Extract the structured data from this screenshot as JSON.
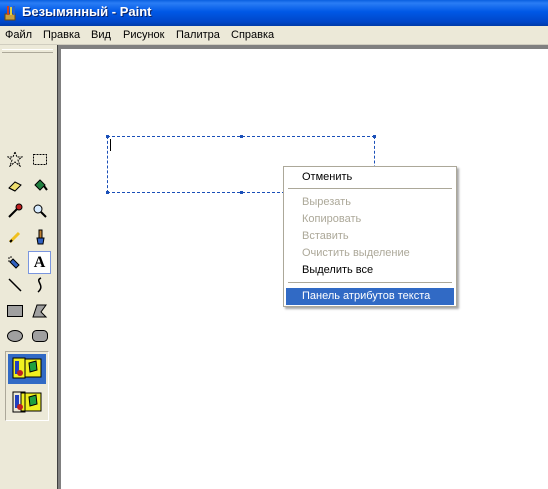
{
  "window": {
    "title": "Безымянный - Paint",
    "title_bar_color": "#0054e3",
    "app_icon": "paint-app-icon"
  },
  "menubar": {
    "items": [
      "Файл",
      "Правка",
      "Вид",
      "Рисунок",
      "Палитра",
      "Справка"
    ]
  },
  "toolbox": {
    "tools": [
      {
        "name": "free-form-select",
        "icon": "star-select-icon"
      },
      {
        "name": "rect-select",
        "icon": "rect-select-icon"
      },
      {
        "name": "eraser",
        "icon": "eraser-icon"
      },
      {
        "name": "fill",
        "icon": "fill-bucket-icon"
      },
      {
        "name": "pick-color",
        "icon": "eyedropper-icon"
      },
      {
        "name": "magnifier",
        "icon": "magnifier-icon"
      },
      {
        "name": "pencil",
        "icon": "pencil-icon"
      },
      {
        "name": "brush",
        "icon": "brush-icon"
      },
      {
        "name": "airbrush",
        "icon": "airbrush-icon"
      },
      {
        "name": "text",
        "icon": "text-icon",
        "active": true
      },
      {
        "name": "line",
        "icon": "line-icon"
      },
      {
        "name": "curve",
        "icon": "curve-icon"
      },
      {
        "name": "rectangle",
        "icon": "rectangle-icon"
      },
      {
        "name": "polygon",
        "icon": "polygon-icon"
      },
      {
        "name": "ellipse",
        "icon": "ellipse-icon"
      },
      {
        "name": "rounded-rectangle",
        "icon": "rounded-rect-icon"
      }
    ],
    "text_glyph": "A",
    "background_options": [
      {
        "name": "opaque",
        "selected": true
      },
      {
        "name": "transparent",
        "selected": false
      }
    ]
  },
  "context_menu": {
    "items": [
      {
        "label": "Отменить",
        "enabled": true
      },
      {
        "label": "Вырезать",
        "enabled": false
      },
      {
        "label": "Копировать",
        "enabled": false
      },
      {
        "label": "Вставить",
        "enabled": false
      },
      {
        "label": "Очистить выделение",
        "enabled": false
      },
      {
        "label": "Выделить все",
        "enabled": true
      },
      {
        "label": "Панель атрибутов текста",
        "enabled": true,
        "highlighted": true
      }
    ],
    "highlight_color": "#316ac5",
    "disabled_color": "#aca899"
  }
}
